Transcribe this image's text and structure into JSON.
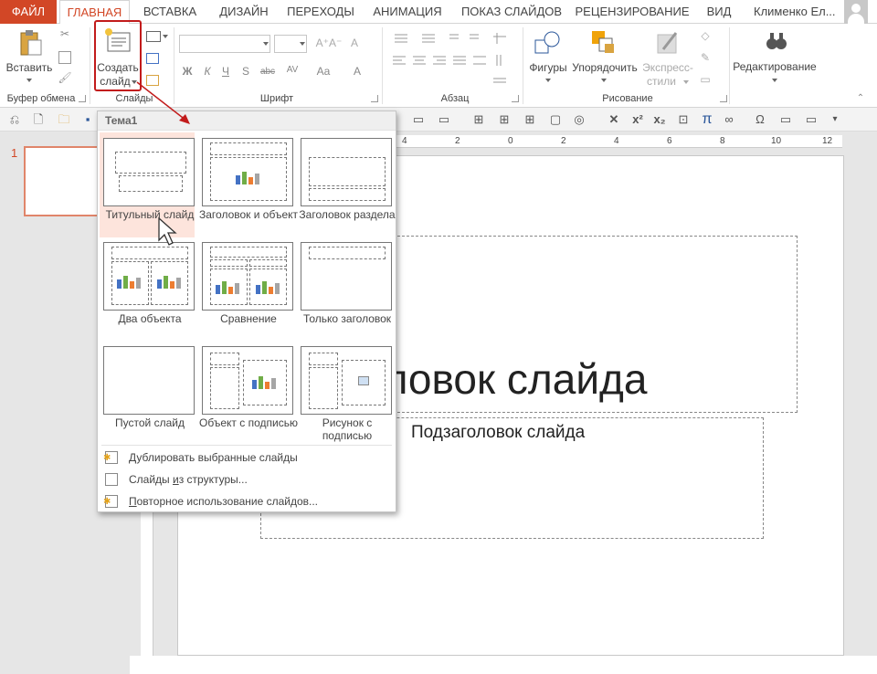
{
  "tabs": [
    "ФАЙЛ",
    "ГЛАВНАЯ",
    "ВСТАВКА",
    "ДИЗАЙН",
    "ПЕРЕХОДЫ",
    "АНИМАЦИЯ",
    "ПОКАЗ СЛАЙДОВ",
    "РЕЦЕНЗИРОВАНИЕ",
    "ВИД"
  ],
  "user": "Клименко Ел...",
  "ribbon": {
    "paste": "Вставить",
    "clipboard_group": "Буфер обмена",
    "new_slide_1": "Создать",
    "new_slide_2": "слайд",
    "slides_group": "Слайды",
    "font_group": "Шрифт",
    "paragraph_group": "Абзац",
    "shapes": "Фигуры",
    "arrange": "Упорядочить",
    "quick_styles_1": "Экспресс-",
    "quick_styles_2": "стили",
    "drawing_group": "Рисование",
    "editing": "Редактирование",
    "font_buttons": [
      "Ж",
      "К",
      "Ч",
      "S",
      "abc",
      "AV",
      "Aa",
      "A"
    ]
  },
  "qat_symbols": [
    "x²",
    "x₂",
    "π",
    "∞",
    "Ω"
  ],
  "slide_number": "1",
  "ruler_labels": [
    "4",
    "2",
    "0",
    "2",
    "4",
    "6",
    "8",
    "10",
    "12"
  ],
  "slide": {
    "title": "оловок слайда",
    "subtitle": "Подзаголовок слайда"
  },
  "dropdown": {
    "theme": "Тема1",
    "layouts": [
      {
        "name": "Титульный слайд"
      },
      {
        "name": "Заголовок и объект"
      },
      {
        "name": "Заголовок раздела"
      },
      {
        "name": "Два объекта"
      },
      {
        "name": "Сравнение"
      },
      {
        "name": "Только заголовок"
      },
      {
        "name": "Пустой слайд"
      },
      {
        "name": "Объект с подписью"
      },
      {
        "name": "Рисунок с подписью"
      }
    ],
    "menu": [
      {
        "underline": "Д",
        "rest": "ублировать выбранные слайды"
      },
      {
        "prefix": "Слайды ",
        "underline": "и",
        "rest": "з структуры..."
      },
      {
        "underline": "П",
        "rest": "овторное использование слайдов..."
      }
    ]
  },
  "colors": {
    "accent": "#d24726",
    "highlight": "#c21b1b",
    "selected_bg": "#fde4dc"
  }
}
